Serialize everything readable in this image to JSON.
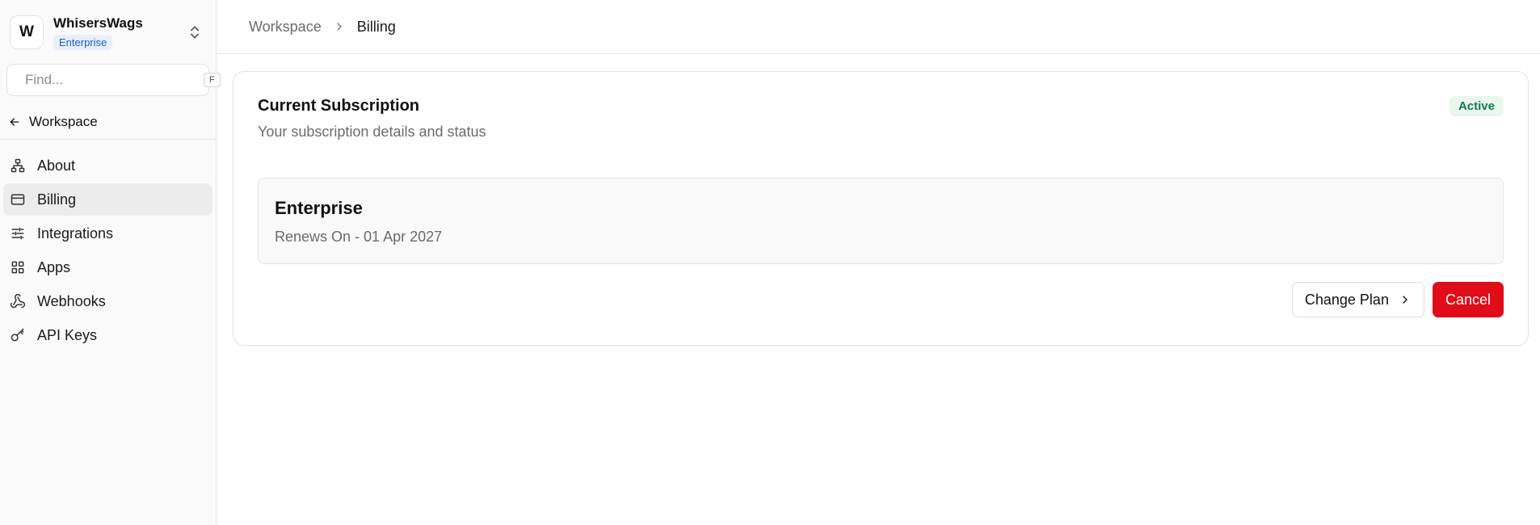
{
  "org": {
    "initial": "W",
    "name": "WhisersWags",
    "plan_badge": "Enterprise",
    "switch_icon": "chevrons-up-down-icon"
  },
  "search": {
    "placeholder": "Find...",
    "shortcut": "F",
    "icon": "search-icon"
  },
  "back": {
    "label": "Workspace",
    "icon": "arrow-left-icon"
  },
  "nav": {
    "items": [
      {
        "label": "About",
        "icon": "sitemap-icon"
      },
      {
        "label": "Billing",
        "icon": "credit-card-icon",
        "active": true
      },
      {
        "label": "Integrations",
        "icon": "sliders-icon"
      },
      {
        "label": "Apps",
        "icon": "grid-icon"
      },
      {
        "label": "Webhooks",
        "icon": "webhook-icon"
      },
      {
        "label": "API Keys",
        "icon": "key-icon"
      }
    ]
  },
  "breadcrumb": {
    "parent": "Workspace",
    "current": "Billing"
  },
  "subscription": {
    "title": "Current Subscription",
    "subtitle": "Your subscription details and status",
    "status": "Active",
    "plan_name": "Enterprise",
    "renews": "Renews On - 01 Apr 2027",
    "change_plan_label": "Change Plan",
    "cancel_label": "Cancel"
  },
  "colors": {
    "accent_badge_bg": "#e8f0fe",
    "accent_badge_text": "#1d5bd6",
    "status_bg": "#e9f7ef",
    "status_text": "#16794a",
    "danger": "#e00c18"
  }
}
